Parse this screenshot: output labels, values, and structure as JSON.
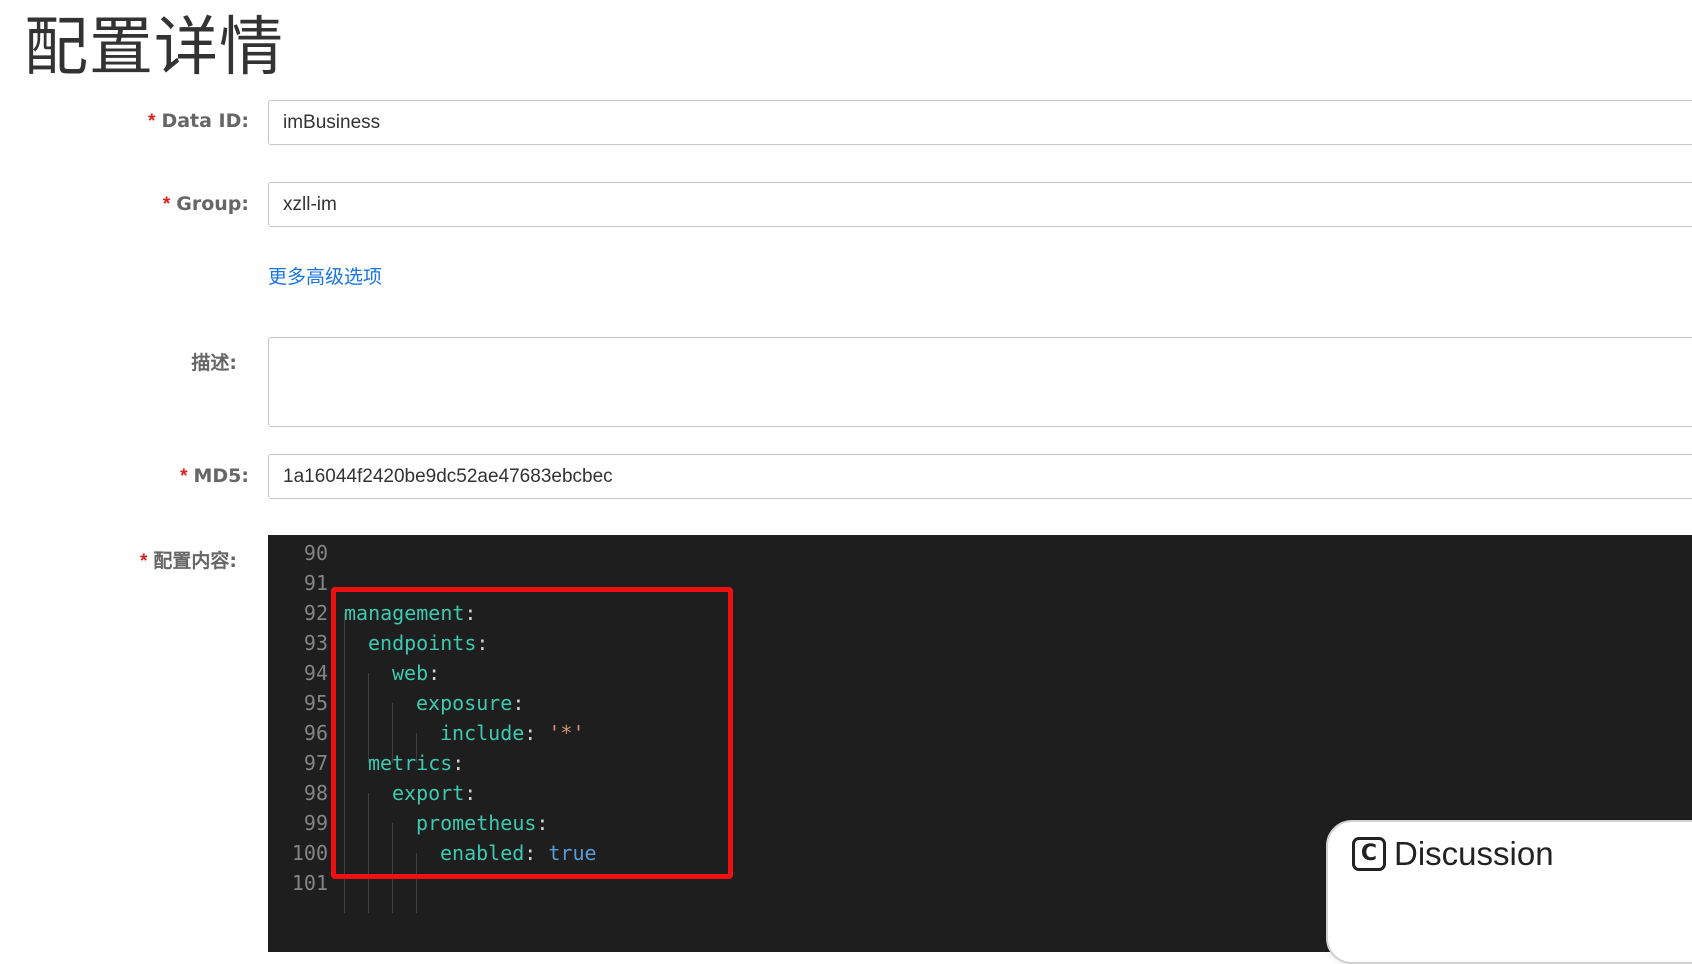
{
  "page": {
    "title": "配置详情"
  },
  "form": {
    "data_id": {
      "required": "*",
      "label": "Data ID:",
      "value": "imBusiness"
    },
    "group": {
      "required": "*",
      "label": "Group:",
      "value": "xzll-im"
    },
    "advanced_link": "更多高级选项",
    "description": {
      "label": "描述:",
      "value": ""
    },
    "md5": {
      "required": "*",
      "label": "MD5:",
      "value": "1a16044f2420be9dc52ae47683ebcbec"
    },
    "content": {
      "required": "*",
      "label": "配置内容:"
    }
  },
  "editor": {
    "lines": [
      {
        "num": "90",
        "key": "",
        "colon": "",
        "value": ""
      },
      {
        "num": "91",
        "key": "",
        "colon": "",
        "value": ""
      },
      {
        "num": "92",
        "key": "management",
        "colon": ":",
        "value": ""
      },
      {
        "num": "93",
        "key": "endpoints",
        "colon": ":",
        "value": ""
      },
      {
        "num": "94",
        "key": "web",
        "colon": ":",
        "value": ""
      },
      {
        "num": "95",
        "key": "exposure",
        "colon": ":",
        "value": ""
      },
      {
        "num": "96",
        "key": "include",
        "colon": ":",
        "value": "'*'"
      },
      {
        "num": "97",
        "key": "metrics",
        "colon": ":",
        "value": ""
      },
      {
        "num": "98",
        "key": "export",
        "colon": ":",
        "value": ""
      },
      {
        "num": "99",
        "key": "prometheus",
        "colon": ":",
        "value": ""
      },
      {
        "num": "100",
        "key": "enabled",
        "colon": ":",
        "value": "true"
      },
      {
        "num": "101",
        "key": "",
        "colon": "",
        "value": ""
      }
    ]
  },
  "discussion_button": {
    "label": "Discussion",
    "icon": "C"
  },
  "colors": {
    "required": "#e02020",
    "link": "#1a75e0",
    "editor_bg": "#1e1e1e",
    "yaml_key": "#3dc9b0",
    "highlight_box": "#ee1111"
  }
}
